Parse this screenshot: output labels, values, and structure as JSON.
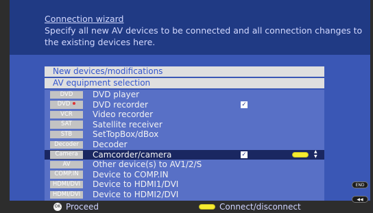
{
  "header": {
    "title": "Connection wizard",
    "description": "Specify all new AV devices to be connected and all connection changes to the existing devices here."
  },
  "bars": {
    "new_devices": "New devices/modifications",
    "av_selection": "AV equipment selection"
  },
  "devices": [
    {
      "tag": "DVD",
      "label": "DVD player",
      "checked": false
    },
    {
      "tag": "DVD",
      "label": "DVD recorder",
      "checked": true,
      "dot_color": "#dd3333"
    },
    {
      "tag": "VCR",
      "label": "Video recorder",
      "checked": false
    },
    {
      "tag": "SAT",
      "label": "Satellite receiver",
      "checked": false
    },
    {
      "tag": "STB",
      "label": "SetTopBox/dBox",
      "checked": false
    },
    {
      "tag": "Decoder",
      "label": "Decoder",
      "checked": false
    },
    {
      "tag": "Camera",
      "label": "Camcorder/camera",
      "checked": true,
      "selected": true
    },
    {
      "tag": "AV",
      "label": "Other device(s) to AV1/2/S",
      "checked": false
    },
    {
      "tag": "COMP.IN",
      "label": "Device to COMP.IN",
      "checked": false
    },
    {
      "tag": "HDMI/DVI",
      "label": "Device to HDMI1/DVI",
      "checked": false
    },
    {
      "tag": "HDMI/DVI",
      "label": "Device to HDMI2/DVI",
      "checked": false
    }
  ],
  "check_glyph": "✓",
  "updown_glyph": "▲\n▼",
  "side_buttons": {
    "end": "END",
    "rewind": "◀◀"
  },
  "footer": {
    "ok_icon": "OK",
    "proceed": "Proceed",
    "connect": "Connect/disconnect"
  },
  "colors": {
    "header_bg": "#203a84",
    "panel_bg": "#3a57b5",
    "list_bg": "#5870c6",
    "selected_row": "#1a2761",
    "yellow_key": "#f5eb30"
  }
}
